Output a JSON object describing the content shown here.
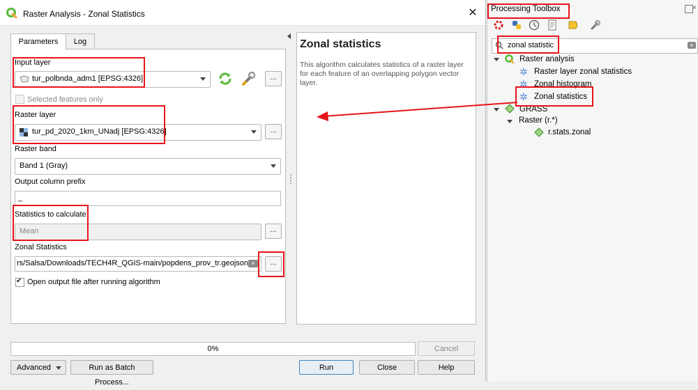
{
  "dialog": {
    "title": "Raster Analysis - Zonal Statistics",
    "close_glyph": "✕",
    "tabs": [
      {
        "label": "Parameters"
      },
      {
        "label": "Log"
      }
    ],
    "input_layer": {
      "label": "Input layer",
      "value": "tur_polbnda_adm1 [EPSG:4326]"
    },
    "selected_only": {
      "label": "Selected features only"
    },
    "raster_layer": {
      "label": "Raster layer",
      "value": "tur_pd_2020_1km_UNadj [EPSG:4326]"
    },
    "raster_band": {
      "label": "Raster band",
      "value": "Band 1 (Gray)"
    },
    "prefix": {
      "label": "Output column prefix",
      "value": "_"
    },
    "stats": {
      "label": "Statistics to calculate",
      "value": "Mean"
    },
    "output": {
      "label": "Zonal Statistics",
      "value": "rs/Salsa/Downloads/TECH4R_QGIS-main/popdens_prov_tr.geojson"
    },
    "open_output": {
      "label": "Open output file after running algorithm"
    },
    "ellipsis": "...",
    "help": {
      "title": "Zonal statistics",
      "desc": "This algorithm calculates statistics of a raster layer for each feature of an overlapping polygon vector layer."
    },
    "progress_text": "0%",
    "progress_value": 0,
    "buttons": {
      "cancel": "Cancel",
      "advanced": "Advanced",
      "batch": "Run as Batch Process...",
      "run": "Run",
      "close": "Close",
      "help": "Help"
    }
  },
  "toolbox": {
    "title": "Processing Toolbox",
    "search_value": "zonal statistic",
    "tree": {
      "raster_analysis": "Raster analysis",
      "raster_layer_zonal": "Raster layer zonal statistics",
      "zonal_histogram": "Zonal histogram",
      "zonal_statistics": "Zonal statistics",
      "grass": "GRASS",
      "raster_r": "Raster (r.*)",
      "r_stats_zonal": "r.stats.zonal"
    }
  },
  "colors": {
    "highlight": "#e8141a",
    "qgis_green": "#59b935"
  }
}
